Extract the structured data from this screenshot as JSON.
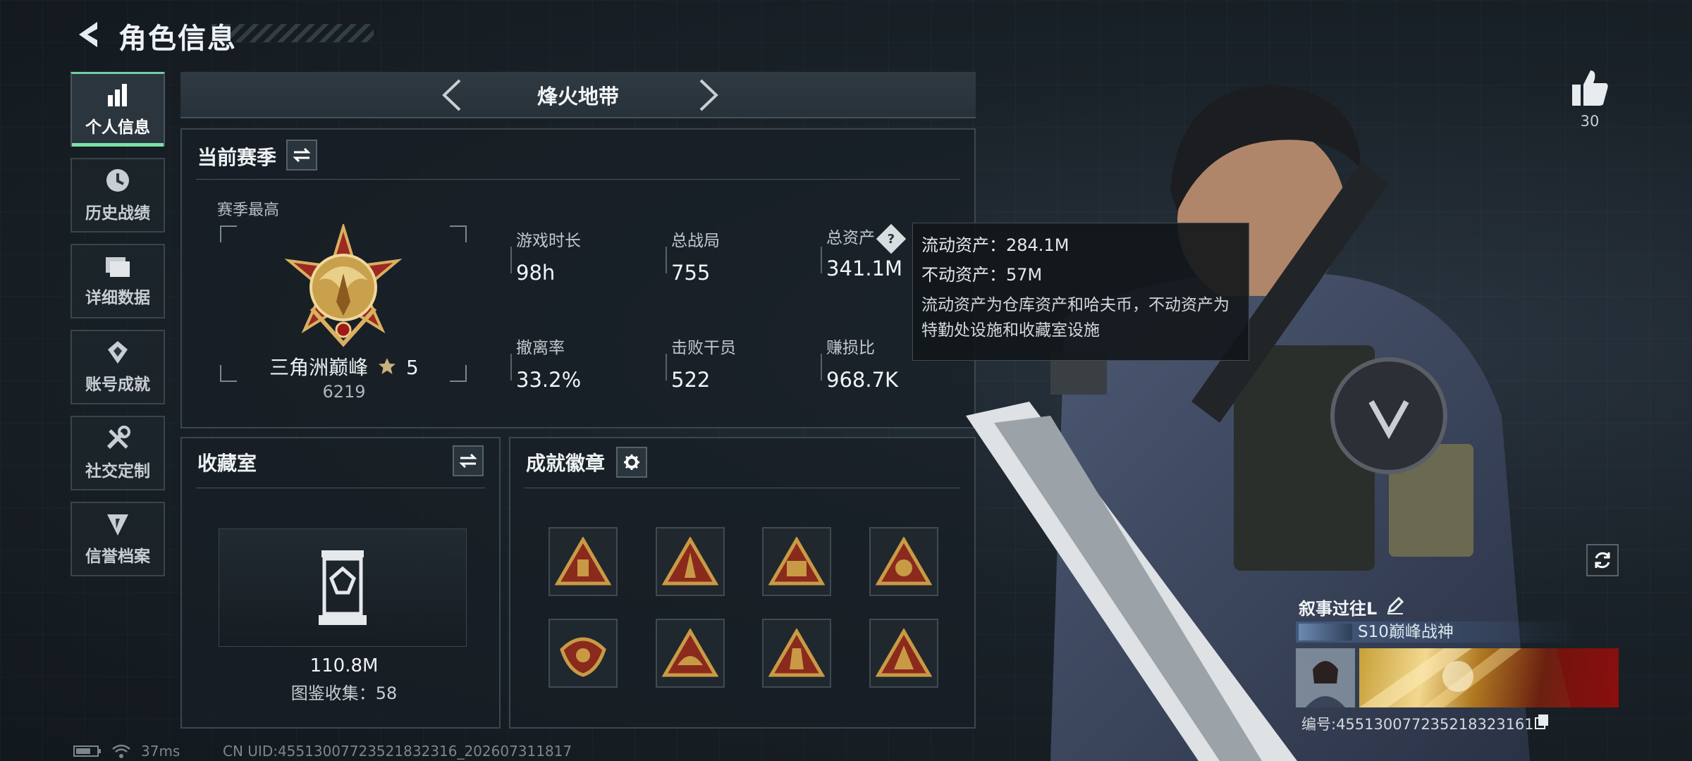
{
  "header": {
    "title": "角色信息"
  },
  "nav": {
    "items": [
      {
        "label": "个人信息",
        "icon": "bar-chart-icon",
        "active": true
      },
      {
        "label": "历史战绩",
        "icon": "clock-icon",
        "active": false
      },
      {
        "label": "详细数据",
        "icon": "folder-icon",
        "active": false
      },
      {
        "label": "账号成就",
        "icon": "achievement-icon",
        "active": false
      },
      {
        "label": "社交定制",
        "icon": "tools-icon",
        "active": false
      },
      {
        "label": "信誉档案",
        "icon": "credit-icon",
        "active": false
      }
    ]
  },
  "mode": {
    "title": "烽火地带"
  },
  "season": {
    "title": "当前赛季",
    "subtitle": "赛季最高",
    "rank_name": "三角洲巅峰",
    "rank_stars": "5",
    "rank_score": "6219",
    "stats": [
      {
        "label": "游戏时长",
        "value": "98h"
      },
      {
        "label": "总战局",
        "value": "755"
      },
      {
        "label": "总资产",
        "value": "341.1M"
      },
      {
        "label": "撤离率",
        "value": "33.2%"
      },
      {
        "label": "击败干员",
        "value": "522"
      },
      {
        "label": "赚损比",
        "value": "968.7K"
      }
    ]
  },
  "tooltip": {
    "liquid": "流动资产：284.1M",
    "fixed": "不动资产：57M",
    "description": "流动资产为仓库资产和哈夫币，不动资产为特勤处设施和收藏室设施"
  },
  "collection": {
    "title": "收藏室",
    "value": "110.8M",
    "count_text": "图鉴收集：58"
  },
  "badges": {
    "title": "成就徽章",
    "items": [
      "badge-1",
      "badge-2",
      "badge-3",
      "badge-4",
      "badge-5",
      "badge-6",
      "badge-7",
      "badge-8"
    ]
  },
  "profile": {
    "likes": "30",
    "name": "叙事过往L",
    "title": "S10巅峰战神",
    "id_text": "编号:455130077235218323161"
  },
  "status_bar": {
    "ping": "37ms",
    "uid": "CN UID:45513007723521832316_202607311817"
  },
  "colors": {
    "accent": "#7ee0a9",
    "badge_gold": "#c99a45",
    "badge_red": "#8a2a1c"
  }
}
